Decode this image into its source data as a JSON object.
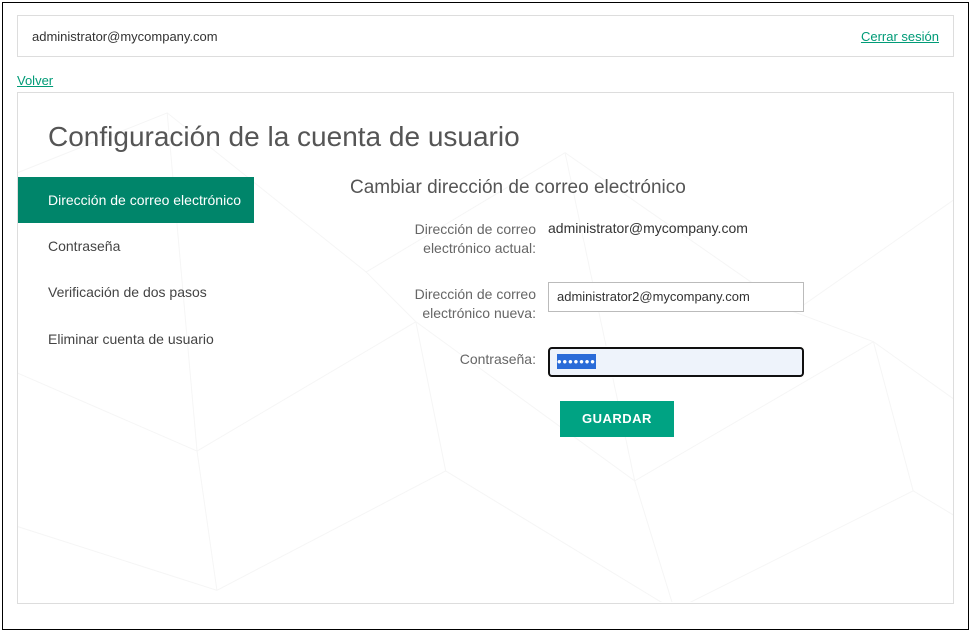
{
  "header": {
    "user_email": "administrator@mycompany.com",
    "logout_label": "Cerrar sesión"
  },
  "back_label": "Volver",
  "page_title": "Configuración de la cuenta de usuario",
  "sidebar": {
    "items": [
      {
        "label": "Dirección de correo electrónico",
        "active": true
      },
      {
        "label": "Contraseña",
        "active": false
      },
      {
        "label": "Verificación de dos pasos",
        "active": false
      },
      {
        "label": "Eliminar cuenta de usuario",
        "active": false
      }
    ]
  },
  "form": {
    "section_title": "Cambiar dirección de correo electrónico",
    "current_email_label": "Dirección de correo electrónico actual:",
    "current_email_value": "administrator@mycompany.com",
    "new_email_label": "Dirección de correo electrónico nueva:",
    "new_email_value": "administrator2@mycompany.com",
    "password_label": "Contraseña:",
    "password_value": "•••••••",
    "save_label": "GUARDAR"
  }
}
